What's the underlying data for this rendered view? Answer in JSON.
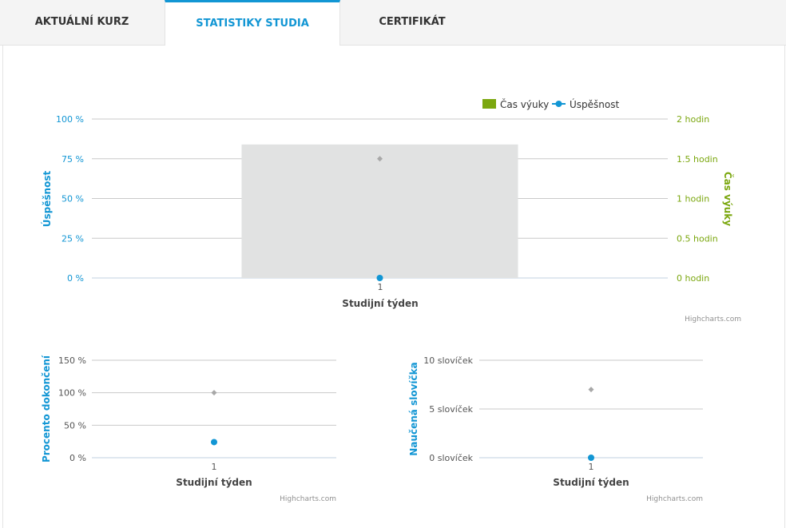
{
  "tabs": [
    {
      "label": "AKTUÁLNÍ KURZ",
      "active": false
    },
    {
      "label": "STATISTIKY STUDIA",
      "active": true
    },
    {
      "label": "CERTIFIKÁT",
      "active": false
    }
  ],
  "colors": {
    "accent": "#1296d4",
    "green": "#7ba70f",
    "bar": "#e1e2e2",
    "grid": "#c9c9c9",
    "target_marker": "#a8a8a8"
  },
  "credits": "Highcharts.com",
  "chart_data": [
    {
      "type": "bar",
      "legend": {
        "position": "top-right",
        "items": [
          "Čas výuky",
          "Úspěšnost"
        ]
      },
      "categories": [
        "1"
      ],
      "xlabel": "Studijní týden",
      "ylabel_left": "Úspěšnost",
      "ylabel_right": "Čas výuky",
      "left_axis": {
        "ylim": [
          0,
          100
        ],
        "ticks": [
          "100 %",
          "75 %",
          "50 %",
          "25 %",
          "0 %"
        ]
      },
      "right_axis": {
        "ylim": [
          0,
          2
        ],
        "ticks": [
          "2 hodin",
          "1.5 hodin",
          "1 hodin",
          "0.5 hodin",
          "0 hodin"
        ]
      },
      "series": [
        {
          "name": "Čas výuky",
          "type": "bar",
          "axis": "right",
          "values": [
            1.68
          ]
        },
        {
          "name": "Úspěšnost",
          "type": "line",
          "axis": "left",
          "values": [
            0
          ]
        },
        {
          "type": "marker",
          "axis": "left",
          "values": [
            75
          ]
        }
      ]
    },
    {
      "type": "scatter",
      "categories": [
        "1"
      ],
      "xlabel": "Studijní týden",
      "ylabel": "Procento dokončení",
      "ylim": [
        0,
        150
      ],
      "ticks": [
        "150  %",
        "100  %",
        "50  %",
        "0  %"
      ],
      "series": [
        {
          "type": "point",
          "values": [
            24
          ]
        },
        {
          "type": "marker",
          "values": [
            100
          ]
        }
      ]
    },
    {
      "type": "scatter",
      "categories": [
        "1"
      ],
      "xlabel": "Studijní týden",
      "ylabel": "Naučená slovíčka",
      "ylim": [
        0,
        10
      ],
      "ticks": [
        "10 slovíček",
        "5 slovíček",
        "0 slovíček"
      ],
      "series": [
        {
          "type": "point",
          "values": [
            0
          ]
        },
        {
          "type": "marker",
          "values": [
            7
          ]
        }
      ]
    }
  ]
}
